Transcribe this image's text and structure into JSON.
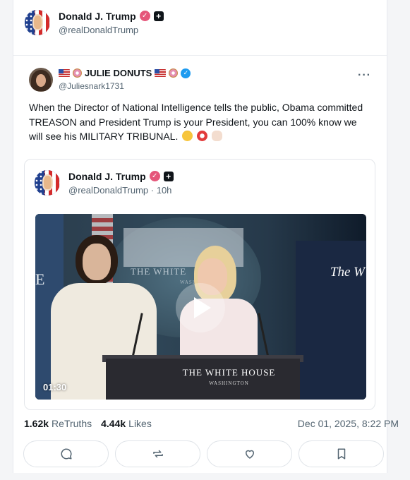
{
  "post": {
    "author_name": "Donald J. Trump",
    "author_handle": "@realDonaldTrump"
  },
  "repost": {
    "author_name": "JULIE DONUTS",
    "author_handle": "@Juliesnark1731",
    "more_label": "···",
    "text": "When the Director of National Intelligence tells the public, Obama committed TREASON and President Trump is your President, you can 100% know we will see his MILITARY TRIBUNAL."
  },
  "quote": {
    "author_name": "Donald J. Trump",
    "author_handle": "@realDonaldTrump",
    "time_ago": "· 10h",
    "video": {
      "duration": "01:30",
      "podium_title": "THE WHITE HOUSE",
      "podium_subtitle": "WASHINGTON",
      "background_title": "THE WHITE",
      "background_subtitle": "WASHIN",
      "right_screen_text": "The W",
      "left_letter": "E"
    }
  },
  "stats": {
    "retruths_count": "1.62k",
    "retruths_label": "ReTruths",
    "likes_count": "4.44k",
    "likes_label": "Likes",
    "timestamp": "Dec 01, 2025, 8:22 PM"
  },
  "actions": [
    "reply-icon",
    "retruth-icon",
    "like-icon",
    "bookmark-icon"
  ],
  "colors": {
    "verified_badge": "#e5567a",
    "blue_check": "#1d9bf0",
    "muted_text": "#536471"
  }
}
